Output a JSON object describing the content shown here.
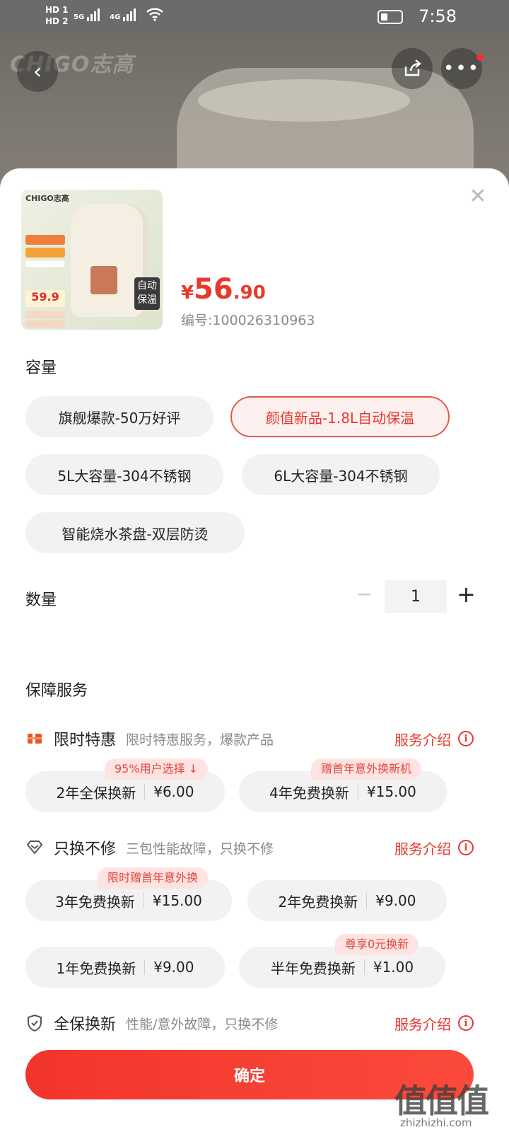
{
  "status_bar": {
    "hd1": "HD 1",
    "hd2": "HD 2",
    "net1": "5G",
    "net2": "4G",
    "time": "7:58"
  },
  "background": {
    "brand_logo": "CHIGO志高"
  },
  "product": {
    "thumb_brand": "CHIGO志高",
    "thumb_price": "59.9",
    "thumb_badge_line1": "自动",
    "thumb_badge_line2": "保温",
    "price_symbol": "¥",
    "price_int": "56",
    "price_dec": ".90",
    "sku": "编号:100026310963"
  },
  "capacity": {
    "title": "容量",
    "options": [
      {
        "label": "旗舰爆款-50万好评",
        "selected": false
      },
      {
        "label": "颜值新品-1.8L自动保温",
        "selected": true
      },
      {
        "label": "5L大容量-304不锈钢",
        "selected": false
      },
      {
        "label": "6L大容量-304不锈钢",
        "selected": false
      },
      {
        "label": "智能烧水茶盘-双层防烫",
        "selected": false
      }
    ]
  },
  "quantity": {
    "title": "数量",
    "minus": "−",
    "value": "1",
    "plus": "+"
  },
  "services": {
    "title": "保障服务",
    "groups": [
      {
        "icon": "gift-box-icon",
        "name": "限时特惠",
        "desc": "限时特惠服务，爆款产品",
        "link": "服务介绍",
        "options": [
          {
            "label": "2年全保换新",
            "price": "¥6.00",
            "tag": "95%用户选择 ↓"
          },
          {
            "label": "4年免费换新",
            "price": "¥15.00",
            "tag": "赠首年意外换新机"
          }
        ]
      },
      {
        "icon": "diamond-icon",
        "name": "只换不修",
        "desc": "三包性能故障，只换不修",
        "link": "服务介绍",
        "options": [
          {
            "label": "3年免费换新",
            "price": "¥15.00",
            "tag": "限时赠首年意外换"
          },
          {
            "label": "2年免费换新",
            "price": "¥9.00",
            "tag": ""
          },
          {
            "label": "1年免费换新",
            "price": "¥9.00",
            "tag": ""
          },
          {
            "label": "半年免费换新",
            "price": "¥1.00",
            "tag": "尊享0元换新"
          }
        ]
      },
      {
        "icon": "shield-check-icon",
        "name": "全保换新",
        "desc": "性能/意外故障，只换不修",
        "link": "服务介绍",
        "options": []
      }
    ]
  },
  "confirm_label": "确定",
  "watermark": {
    "text": "值值值",
    "url": "zhizhizhi.com"
  },
  "colors": {
    "accent": "#e8382c",
    "tag_bg": "#fde3e1",
    "chip_bg": "#f2f2f2"
  }
}
